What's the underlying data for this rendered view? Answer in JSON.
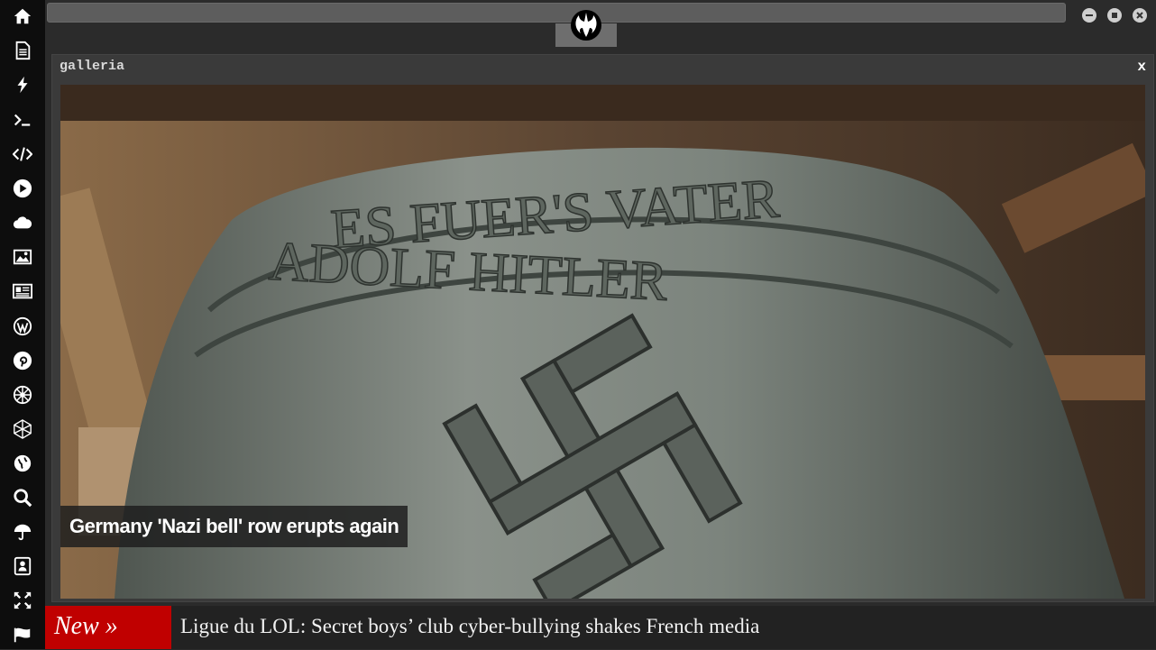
{
  "sidebar": {
    "icons": [
      "home-icon",
      "document-icon",
      "bolt-icon",
      "terminal-icon",
      "code-icon",
      "play-icon",
      "cloud-icon",
      "image-icon",
      "news-icon",
      "wordpress-icon",
      "pinterest-icon",
      "rebel-alliance-icon",
      "network-icon",
      "globe-icon",
      "search-icon",
      "umbrella-icon",
      "contact-card-icon",
      "expand-icon",
      "flag-icon"
    ]
  },
  "topbar": {
    "address_value": "",
    "logo": "rebel-alliance-icon"
  },
  "window": {
    "title": "galleria",
    "close_label": "x",
    "caption": "Germany 'Nazi bell' row erupts again",
    "bell_line1": "ES FUER'S VATER",
    "bell_line2": "ADOLF HITLER"
  },
  "ticker": {
    "badge": "New »",
    "headline": "Ligue du LOL: Secret boys’ club cyber-bullying shakes French media"
  },
  "colors": {
    "sidebar_bg": "#0d0d0d",
    "chrome_bg": "#2b2b2b",
    "badge_red": "#c00000"
  }
}
